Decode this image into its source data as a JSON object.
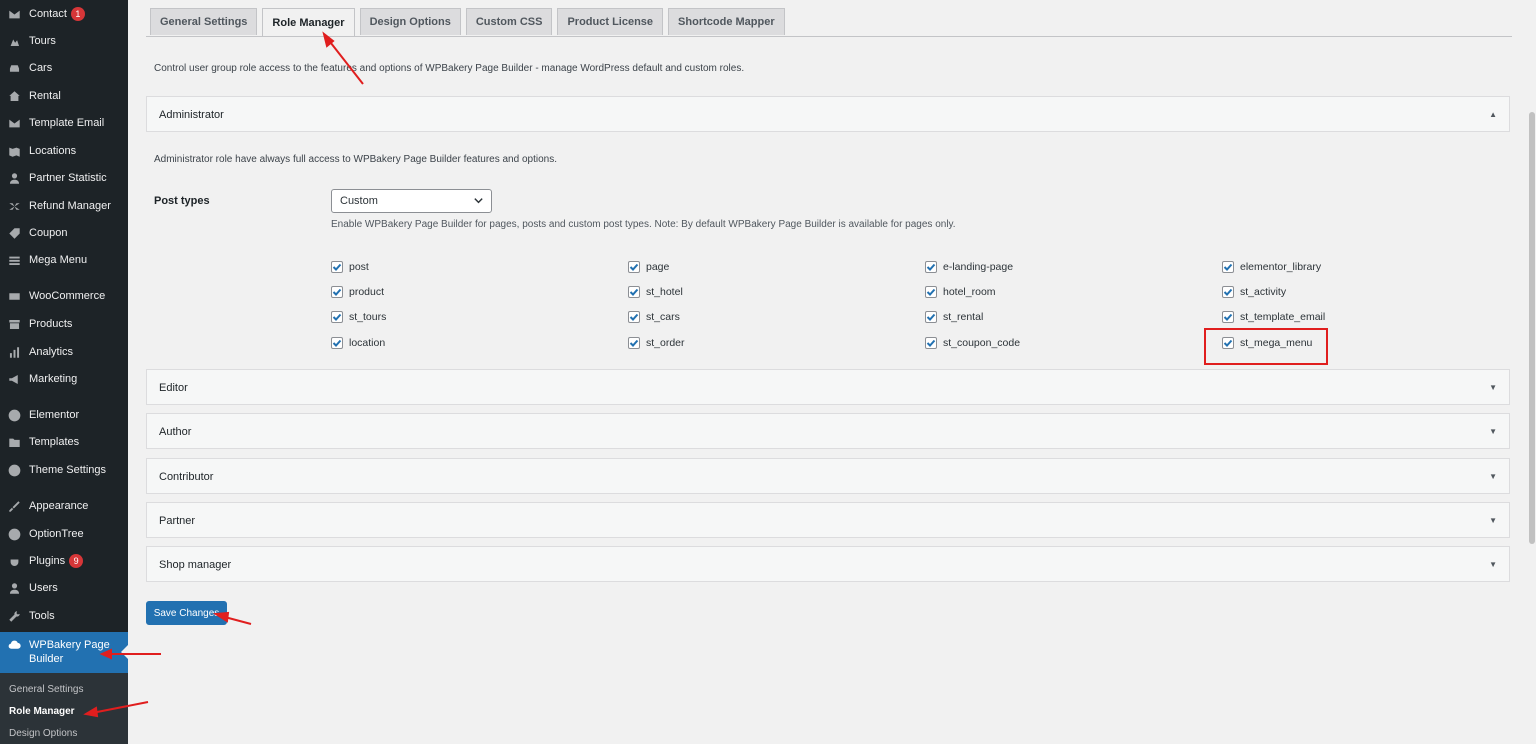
{
  "sidebar": {
    "items": [
      {
        "label": "Contact",
        "icon": "mail-icon",
        "badge": "1"
      },
      {
        "label": "Tours",
        "icon": "tours-icon"
      },
      {
        "label": "Cars",
        "icon": "car-icon"
      },
      {
        "label": "Rental",
        "icon": "home-icon"
      },
      {
        "label": "Template Email",
        "icon": "mail-icon"
      },
      {
        "label": "Locations",
        "icon": "map-icon"
      },
      {
        "label": "Partner Statistic",
        "icon": "user-icon"
      },
      {
        "label": "Refund Manager",
        "icon": "shuffle-icon"
      },
      {
        "label": "Coupon",
        "icon": "tag-icon"
      },
      {
        "label": "Mega Menu",
        "icon": "menu-icon"
      },
      {
        "label": "WooCommerce",
        "icon": "woo-icon"
      },
      {
        "label": "Products",
        "icon": "archive-icon"
      },
      {
        "label": "Analytics",
        "icon": "chart-icon"
      },
      {
        "label": "Marketing",
        "icon": "megaphone-icon"
      },
      {
        "label": "Elementor",
        "icon": "elementor-icon"
      },
      {
        "label": "Templates",
        "icon": "folder-icon"
      },
      {
        "label": "Theme Settings",
        "icon": "clock-icon"
      },
      {
        "label": "Appearance",
        "icon": "brush-icon"
      },
      {
        "label": "OptionTree",
        "icon": "tree-icon"
      },
      {
        "label": "Plugins",
        "icon": "plug-icon",
        "badge": "9"
      },
      {
        "label": "Users",
        "icon": "user-icon"
      },
      {
        "label": "Tools",
        "icon": "wrench-icon"
      }
    ],
    "active_label": "WPBakery Page Builder",
    "submenu": [
      "General Settings",
      "Role Manager",
      "Design Options"
    ]
  },
  "tabs": [
    "General Settings",
    "Role Manager",
    "Design Options",
    "Custom CSS",
    "Product License",
    "Shortcode Mapper"
  ],
  "intro": "Control user group role access to the features and options of WPBakery Page Builder - manage WordPress default and custom roles.",
  "admin": {
    "title": "Administrator",
    "description": "Administrator role have always full access to WPBakery Page Builder features and options.",
    "post_types_label": "Post types",
    "select_value": "Custom",
    "help": "Enable WPBakery Page Builder for pages, posts and custom post types. Note: By default WPBakery Page Builder is available for pages only.",
    "checkboxes": [
      [
        "post",
        "page",
        "e-landing-page",
        "elementor_library"
      ],
      [
        "product",
        "st_hotel",
        "hotel_room",
        "st_activity"
      ],
      [
        "st_tours",
        "st_cars",
        "st_rental",
        "st_template_email"
      ],
      [
        "location",
        "st_order",
        "st_coupon_code",
        "st_mega_menu"
      ]
    ]
  },
  "roles": [
    "Editor",
    "Author",
    "Contributor",
    "Partner",
    "Shop manager"
  ],
  "save_label": "Save Changes",
  "caret_up": "▲",
  "caret_down": "▼"
}
